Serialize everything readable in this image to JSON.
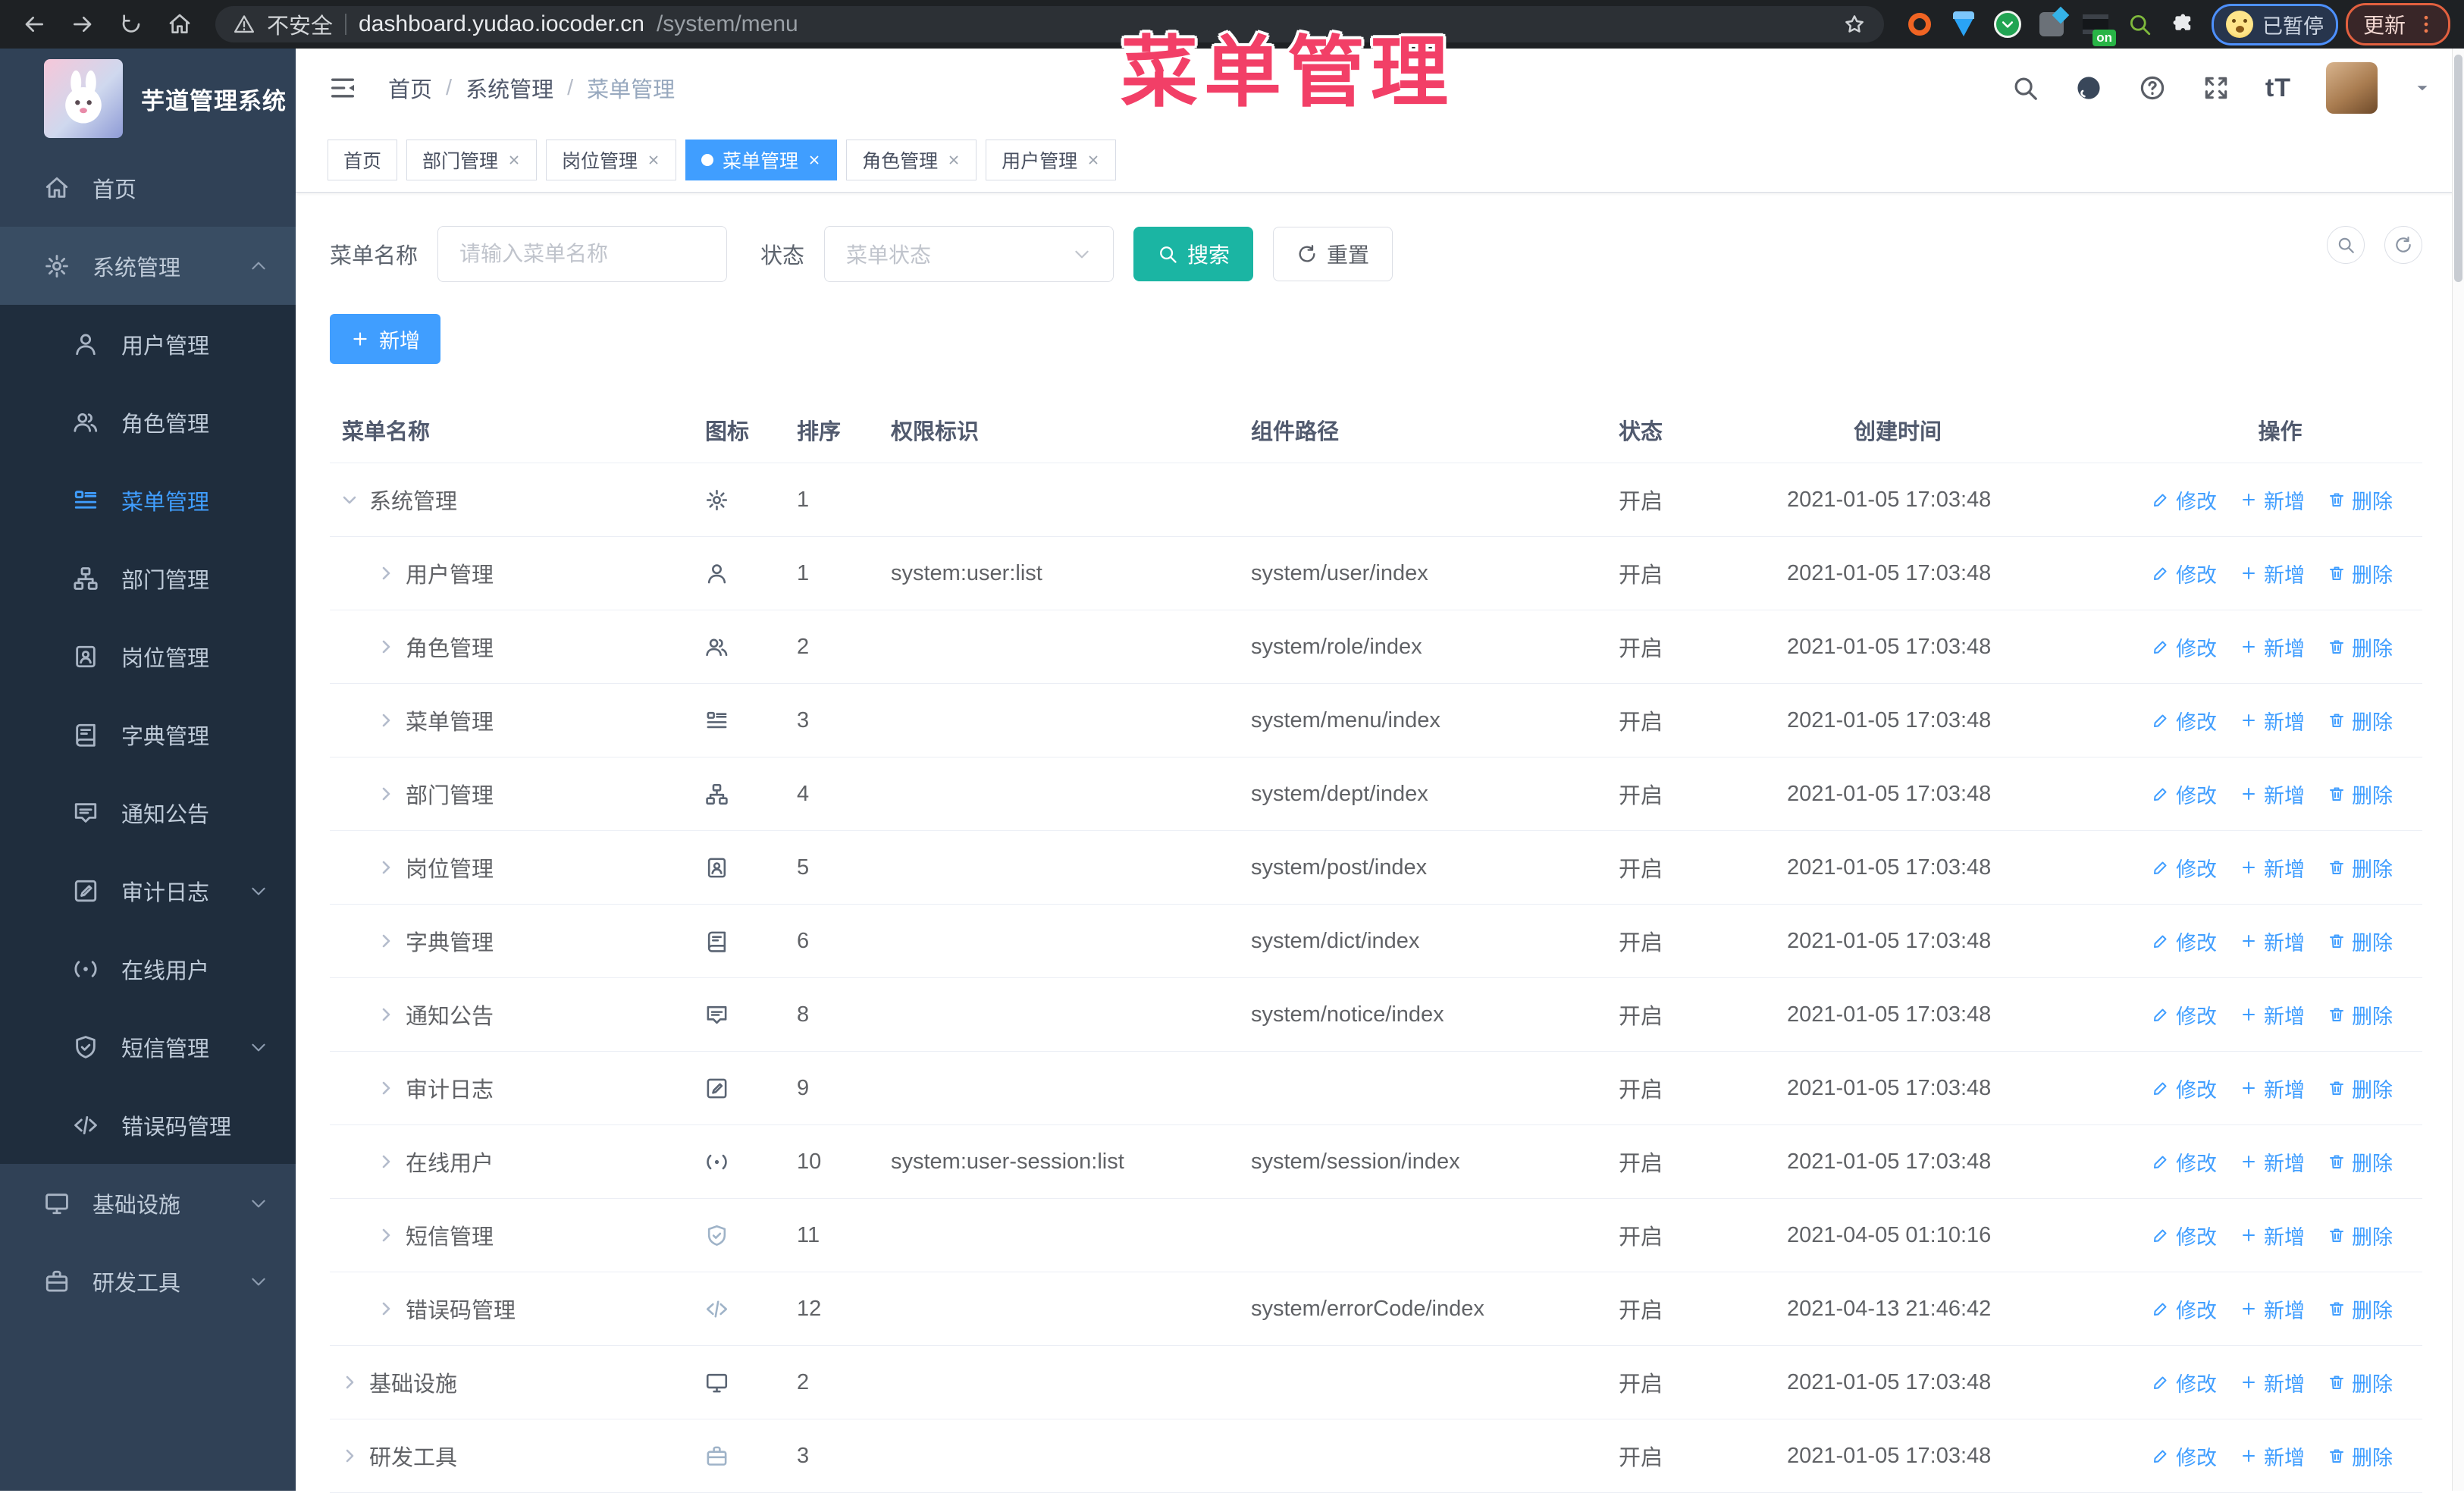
{
  "browser": {
    "security_label": "不安全",
    "url_host": "dashboard.yudao.iocoder.cn",
    "url_path": "/system/menu",
    "extension_badge": "on",
    "paused_label": "已暂停",
    "update_label": "更新"
  },
  "overlay_title": "菜单管理",
  "sidebar": {
    "title": "芋道管理系统",
    "items": [
      {
        "label": "首页",
        "icon": "home-icon"
      },
      {
        "label": "系统管理",
        "icon": "gear-icon"
      },
      {
        "label": "用户管理",
        "icon": "user-icon"
      },
      {
        "label": "角色管理",
        "icon": "users-icon"
      },
      {
        "label": "菜单管理",
        "icon": "menu-list-icon"
      },
      {
        "label": "部门管理",
        "icon": "org-tree-icon"
      },
      {
        "label": "岗位管理",
        "icon": "id-badge-icon"
      },
      {
        "label": "字典管理",
        "icon": "book-icon"
      },
      {
        "label": "通知公告",
        "icon": "message-icon"
      },
      {
        "label": "审计日志",
        "icon": "edit-note-icon"
      },
      {
        "label": "在线用户",
        "icon": "online-icon"
      },
      {
        "label": "短信管理",
        "icon": "shield-check-icon"
      },
      {
        "label": "错误码管理",
        "icon": "code-icon"
      },
      {
        "label": "基础设施",
        "icon": "monitor-icon"
      },
      {
        "label": "研发工具",
        "icon": "toolbox-icon"
      }
    ]
  },
  "breadcrumb": {
    "items": [
      {
        "label": "首页"
      },
      {
        "label": "系统管理"
      },
      {
        "label": "菜单管理"
      }
    ]
  },
  "tabs": [
    {
      "label": "首页"
    },
    {
      "label": "部门管理"
    },
    {
      "label": "岗位管理"
    },
    {
      "label": "菜单管理"
    },
    {
      "label": "角色管理"
    },
    {
      "label": "用户管理"
    }
  ],
  "filters": {
    "name_label": "菜单名称",
    "name_placeholder": "请输入菜单名称",
    "status_label": "状态",
    "status_placeholder": "菜单状态",
    "search_label": "搜索",
    "reset_label": "重置",
    "add_label": "新增"
  },
  "table": {
    "headers": [
      "菜单名称",
      "图标",
      "排序",
      "权限标识",
      "组件路径",
      "状态",
      "创建时间",
      "操作"
    ],
    "actions": {
      "edit": "修改",
      "add": "新增",
      "delete": "删除"
    },
    "rows": [
      {
        "name": "系统管理",
        "sort": "1",
        "perm": "",
        "path": "",
        "status": "开启",
        "created": "2021-01-05 17:03:48"
      },
      {
        "name": "用户管理",
        "sort": "1",
        "perm": "system:user:list",
        "path": "system/user/index",
        "status": "开启",
        "created": "2021-01-05 17:03:48"
      },
      {
        "name": "角色管理",
        "sort": "2",
        "perm": "",
        "path": "system/role/index",
        "status": "开启",
        "created": "2021-01-05 17:03:48"
      },
      {
        "name": "菜单管理",
        "sort": "3",
        "perm": "",
        "path": "system/menu/index",
        "status": "开启",
        "created": "2021-01-05 17:03:48"
      },
      {
        "name": "部门管理",
        "sort": "4",
        "perm": "",
        "path": "system/dept/index",
        "status": "开启",
        "created": "2021-01-05 17:03:48"
      },
      {
        "name": "岗位管理",
        "sort": "5",
        "perm": "",
        "path": "system/post/index",
        "status": "开启",
        "created": "2021-01-05 17:03:48"
      },
      {
        "name": "字典管理",
        "sort": "6",
        "perm": "",
        "path": "system/dict/index",
        "status": "开启",
        "created": "2021-01-05 17:03:48"
      },
      {
        "name": "通知公告",
        "sort": "8",
        "perm": "",
        "path": "system/notice/index",
        "status": "开启",
        "created": "2021-01-05 17:03:48"
      },
      {
        "name": "审计日志",
        "sort": "9",
        "perm": "",
        "path": "",
        "status": "开启",
        "created": "2021-01-05 17:03:48"
      },
      {
        "name": "在线用户",
        "sort": "10",
        "perm": "system:user-session:list",
        "path": "system/session/index",
        "status": "开启",
        "created": "2021-01-05 17:03:48"
      },
      {
        "name": "短信管理",
        "sort": "11",
        "perm": "",
        "path": "",
        "status": "开启",
        "created": "2021-04-05 01:10:16"
      },
      {
        "name": "错误码管理",
        "sort": "12",
        "perm": "",
        "path": "system/errorCode/index",
        "status": "开启",
        "created": "2021-04-13 21:46:42"
      },
      {
        "name": "基础设施",
        "sort": "2",
        "perm": "",
        "path": "",
        "status": "开启",
        "created": "2021-01-05 17:03:48"
      },
      {
        "name": "研发工具",
        "sort": "3",
        "perm": "",
        "path": "",
        "status": "开启",
        "created": "2021-01-05 17:03:48"
      }
    ]
  }
}
